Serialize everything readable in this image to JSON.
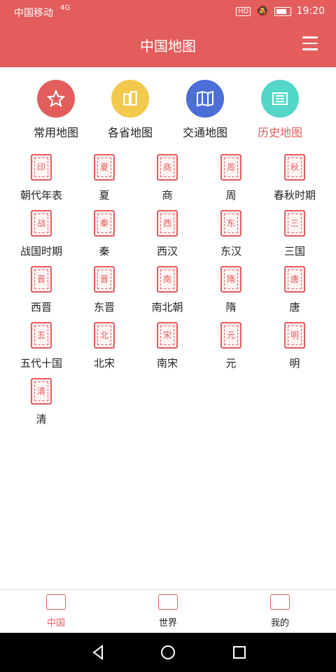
{
  "status": {
    "carrier": "中国移动",
    "net": "4G",
    "time": "19:20",
    "hd": "HD"
  },
  "header": {
    "title": "中国地图"
  },
  "categories": [
    {
      "label": "常用地图",
      "color": "#e35d5d",
      "icon": "star-icon"
    },
    {
      "label": "各省地图",
      "color": "#f2c94c",
      "icon": "buildings-icon"
    },
    {
      "label": "交通地图",
      "color": "#4b6fd6",
      "icon": "map-icon"
    },
    {
      "label": "历史地图",
      "color": "#54d6c8",
      "icon": "scroll-icon",
      "active": true
    }
  ],
  "dynasties": [
    {
      "label": "朝代年表",
      "seal": "印"
    },
    {
      "label": "夏",
      "seal": "夏"
    },
    {
      "label": "商",
      "seal": "商"
    },
    {
      "label": "周",
      "seal": "周"
    },
    {
      "label": "春秋时期",
      "seal": "秋"
    },
    {
      "label": "战国时期",
      "seal": "战"
    },
    {
      "label": "秦",
      "seal": "秦"
    },
    {
      "label": "西汉",
      "seal": "西"
    },
    {
      "label": "东汉",
      "seal": "东"
    },
    {
      "label": "三国",
      "seal": "三"
    },
    {
      "label": "西晋",
      "seal": "晋"
    },
    {
      "label": "东晋",
      "seal": "晋"
    },
    {
      "label": "南北朝",
      "seal": "南"
    },
    {
      "label": "隋",
      "seal": "隋"
    },
    {
      "label": "唐",
      "seal": "唐"
    },
    {
      "label": "五代十国",
      "seal": "五"
    },
    {
      "label": "北宋",
      "seal": "北"
    },
    {
      "label": "南宋",
      "seal": "宋"
    },
    {
      "label": "元",
      "seal": "元"
    },
    {
      "label": "明",
      "seal": "明"
    },
    {
      "label": "清",
      "seal": "清"
    }
  ],
  "bottom_nav": [
    {
      "label": "中国",
      "active": true,
      "icon": "china-map-icon"
    },
    {
      "label": "世界",
      "icon": "world-map-icon"
    },
    {
      "label": "我的",
      "icon": "profile-icon"
    }
  ],
  "accent": "#e35d5d"
}
